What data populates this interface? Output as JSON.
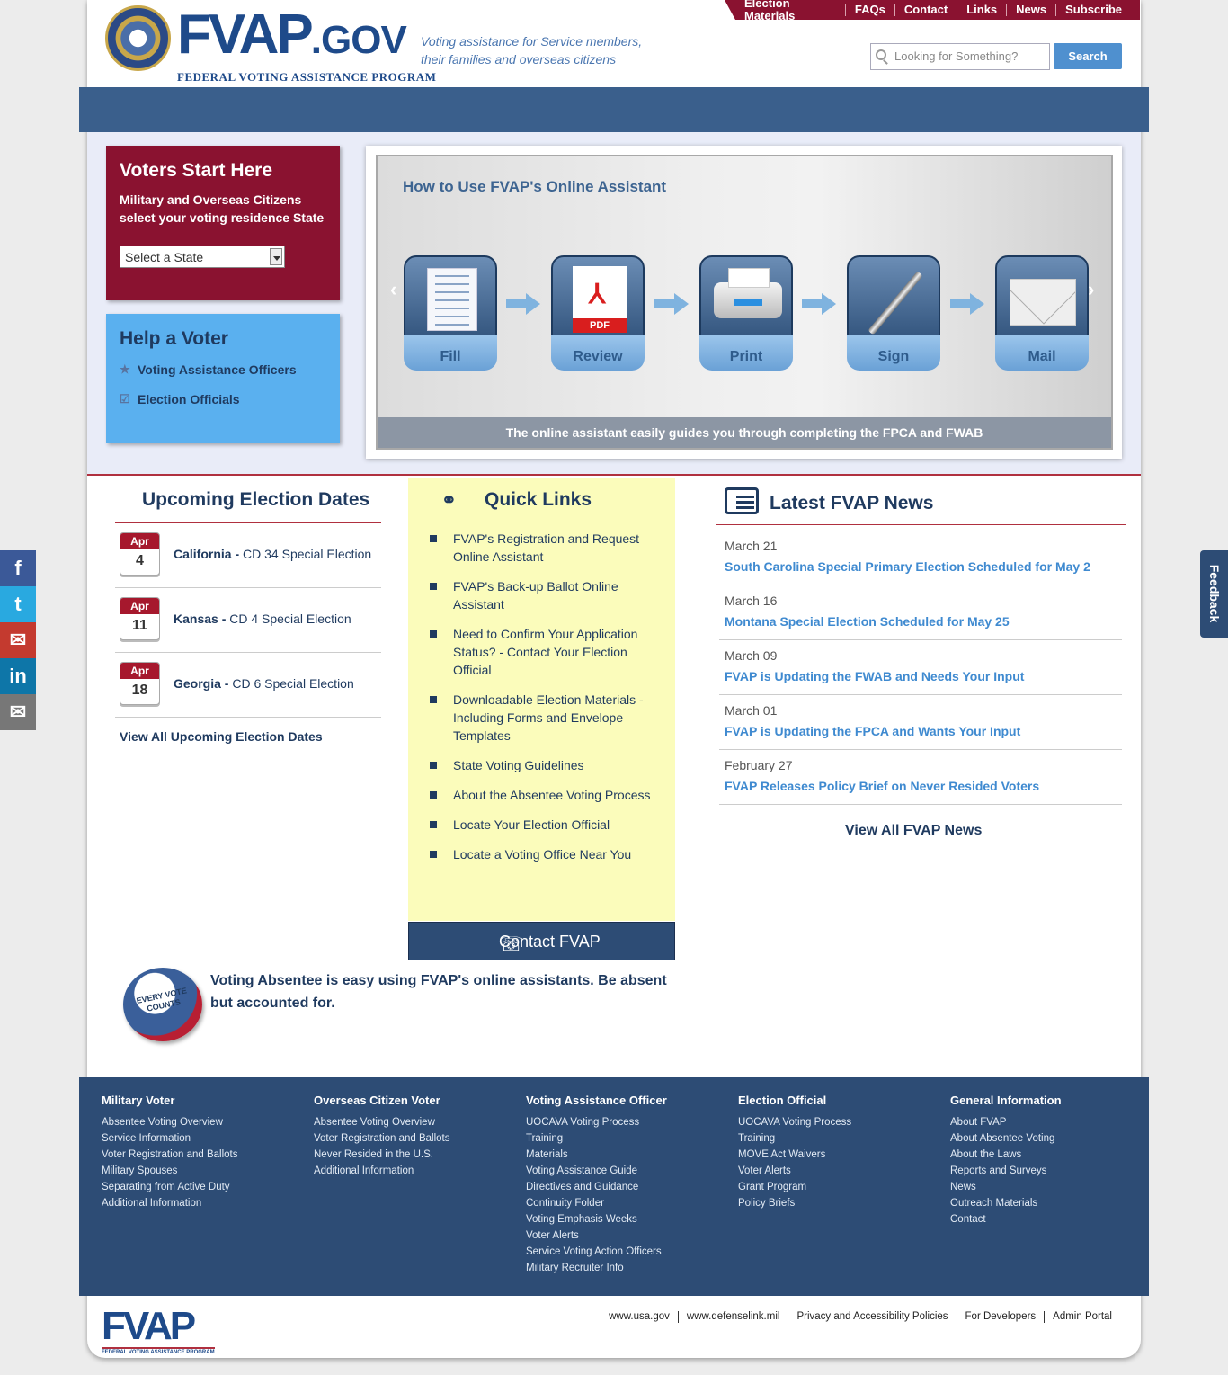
{
  "topnav": [
    "Election Materials",
    "FAQs",
    "Contact",
    "Links",
    "News",
    "Subscribe"
  ],
  "header": {
    "logo_main": "FVAP",
    "logo_suffix": ".GOV",
    "logo_sub": "FEDERAL VOTING ASSISTANCE PROGRAM",
    "tagline": "Voting assistance for Service members, their families and overseas citizens",
    "search_placeholder": "Looking for Something?",
    "search_button": "Search"
  },
  "voters": {
    "title": "Voters Start Here",
    "text": "Military and Overseas Citizens select your voting residence State",
    "select_value": "Select a State"
  },
  "help": {
    "title": "Help a Voter",
    "items": [
      "Voting Assistance Officers",
      "Election Officials"
    ]
  },
  "carousel": {
    "title": "How to Use FVAP's Online Assistant",
    "steps": [
      "Fill",
      "Review",
      "Print",
      "Sign",
      "Mail"
    ],
    "pdf_label": "PDF",
    "caption": "The online assistant easily guides you through completing the FPCA and FWAB"
  },
  "elections": {
    "title": "Upcoming Election Dates",
    "items": [
      {
        "month": "Apr",
        "day": "4",
        "state": "California",
        "race": "CD 34 Special Election"
      },
      {
        "month": "Apr",
        "day": "11",
        "state": "Kansas",
        "race": "CD 4 Special Election"
      },
      {
        "month": "Apr",
        "day": "18",
        "state": "Georgia",
        "race": "CD 6 Special Election"
      }
    ],
    "view_all": "View All Upcoming Election Dates"
  },
  "quick_links": {
    "title": "Quick Links",
    "items": [
      "FVAP's Registration and Request Online Assistant",
      "FVAP's Back-up Ballot Online Assistant",
      "Need to Confirm Your Application Status? - Contact Your Election Official",
      "Downloadable Election Materials - Including Forms and Envelope Templates",
      "State Voting Guidelines",
      "About the Absentee Voting Process",
      "Locate Your Election Official",
      "Locate a Voting Office Near You"
    ],
    "contact": "Contact FVAP"
  },
  "absentee": {
    "text": "Voting Absentee is easy using FVAP's online assistants. Be absent but accounted for.",
    "badge": "EVERY VOTE COUNTS"
  },
  "news": {
    "title": "Latest FVAP News",
    "items": [
      {
        "date": "March 21",
        "headline": "South Carolina Special Primary Election Scheduled for May 2"
      },
      {
        "date": "March 16",
        "headline": "Montana Special Election Scheduled for May 25"
      },
      {
        "date": "March 09",
        "headline": "FVAP is Updating the FWAB and Needs Your Input"
      },
      {
        "date": "March 01",
        "headline": "FVAP is Updating the FPCA and Wants Your Input"
      },
      {
        "date": "February 27",
        "headline": "FVAP Releases Policy Brief on Never Resided Voters"
      }
    ],
    "view_all": "View All FVAP News"
  },
  "footer": {
    "columns": [
      {
        "title": "Military Voter",
        "links": [
          "Absentee Voting Overview",
          "Service Information",
          "Voter Registration and Ballots",
          "Military Spouses",
          "Separating from Active Duty",
          "Additional Information"
        ]
      },
      {
        "title": "Overseas Citizen Voter",
        "links": [
          "Absentee Voting Overview",
          "Voter Registration and Ballots",
          "Never Resided in the U.S.",
          "Additional Information"
        ]
      },
      {
        "title": "Voting Assistance Officer",
        "links": [
          "UOCAVA Voting Process",
          "Training",
          "Materials",
          "Voting Assistance Guide",
          "Directives and Guidance",
          "Continuity Folder",
          "Voting Emphasis Weeks",
          "Voter Alerts",
          "Service Voting Action Officers",
          "Military Recruiter Info"
        ]
      },
      {
        "title": "Election Official",
        "links": [
          "UOCAVA Voting Process",
          "Training",
          "MOVE Act Waivers",
          "Voter Alerts",
          "Grant Program",
          "Policy Briefs"
        ]
      },
      {
        "title": "General Information",
        "links": [
          "About FVAP",
          "About Absentee Voting",
          "About the Laws",
          "Reports and Surveys",
          "News",
          "Outreach Materials",
          "Contact"
        ]
      }
    ],
    "logo": "FVAP",
    "logo_sub": "FEDERAL VOTING ASSISTANCE PROGRAM",
    "bottom_links": [
      "www.usa.gov",
      "www.defenselink.mil",
      "Privacy and Accessibility Policies",
      "For Developers",
      "Admin Portal"
    ]
  },
  "social": [
    {
      "icon": "facebook-icon",
      "glyph": "f",
      "color": "#3b5998"
    },
    {
      "icon": "twitter-icon",
      "glyph": "t",
      "color": "#29a9e0"
    },
    {
      "icon": "email-share-icon",
      "glyph": "✉",
      "color": "#c43a2f"
    },
    {
      "icon": "linkedin-icon",
      "glyph": "in",
      "color": "#0e76a8"
    },
    {
      "icon": "mail-icon",
      "glyph": "✉",
      "color": "#777777"
    }
  ],
  "feedback": "Feedback"
}
